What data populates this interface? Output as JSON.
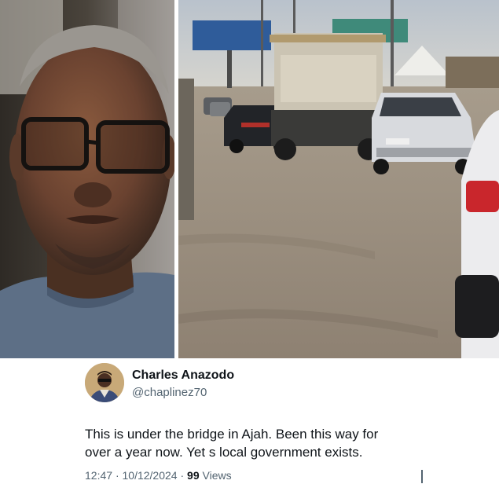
{
  "tweet": {
    "author_name": "Charles Anazodo",
    "author_handle": "@chaplinez70",
    "text_line1": "This is under the bridge in Ajah. Been this way for",
    "text_line2": "over a year now. Yet s local government exists.",
    "time": "12:47",
    "date": "10/12/2024",
    "separator": "·",
    "views_count": "99",
    "views_label": "Views"
  },
  "colors": {
    "text_primary": "#0f1419",
    "text_secondary": "#536471",
    "background": "#ffffff"
  },
  "icons": {
    "avatar": "profile-avatar"
  }
}
